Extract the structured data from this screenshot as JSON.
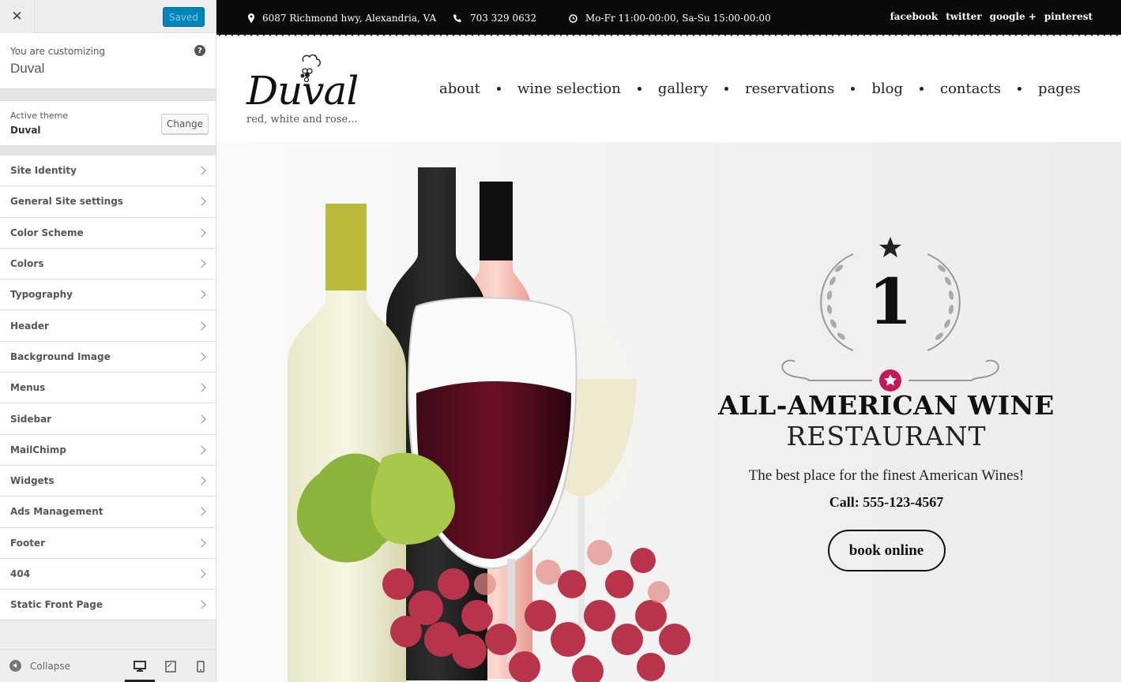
{
  "sidebar": {
    "close_icon": "close-icon",
    "saved_label": "Saved",
    "customizing_label": "You are customizing",
    "site_name": "Duval",
    "help_icon": "?",
    "active_theme_label": "Active theme",
    "active_theme_name": "Duval",
    "change_label": "Change",
    "panels": [
      {
        "label": "Site Identity"
      },
      {
        "label": "General Site settings"
      },
      {
        "label": "Color Scheme"
      },
      {
        "label": "Colors"
      },
      {
        "label": "Typography"
      },
      {
        "label": "Header"
      },
      {
        "label": "Background Image"
      },
      {
        "label": "Menus"
      },
      {
        "label": "Sidebar"
      },
      {
        "label": "MailChimp"
      },
      {
        "label": "Widgets"
      },
      {
        "label": "Ads Management"
      },
      {
        "label": "Footer"
      },
      {
        "label": "404"
      },
      {
        "label": "Static Front Page"
      }
    ],
    "collapse_label": "Collapse",
    "devices": [
      "desktop",
      "tablet",
      "mobile"
    ],
    "active_device": "desktop"
  },
  "preview": {
    "topbar": {
      "address": "6087 Richmond hwy, Alexandria, VA",
      "phone": "703 329 0632",
      "hours": "Mo-Fr 11:00-00:00, Sa-Su 15:00-00:00",
      "social": [
        "facebook",
        "twitter",
        "google +",
        "pinterest"
      ]
    },
    "logo": {
      "name": "Duval",
      "tagline": "red, white and rose..."
    },
    "nav": [
      "about",
      "wine selection",
      "gallery",
      "reservations",
      "blog",
      "contacts",
      "pages"
    ],
    "hero": {
      "badge_number": "1",
      "title_line1": "ALL-AMERICAN WINE",
      "title_line2": "RESTAURANT",
      "subtitle": "The best place for the finest American Wines!",
      "call": "Call: 555-123-4567",
      "button": "book online",
      "accent_color": "#c2185b"
    }
  }
}
